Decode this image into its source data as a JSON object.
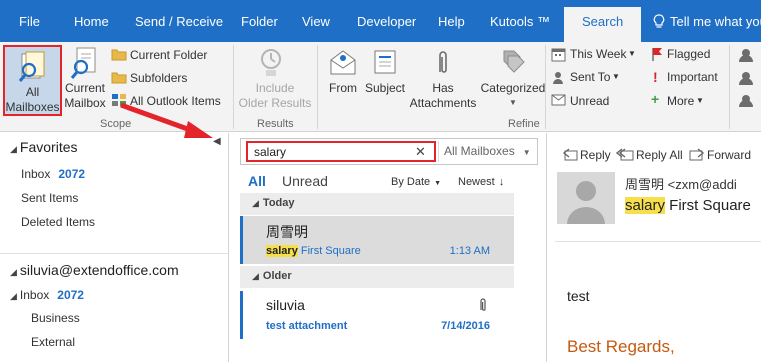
{
  "tabs": [
    "File",
    "Home",
    "Send / Receive",
    "Folder",
    "View",
    "Developer",
    "Help",
    "Kutools ™"
  ],
  "active_tab": "Search",
  "tell_me": "Tell me what you",
  "ribbon": {
    "scope": {
      "all_mailboxes_1": "All",
      "all_mailboxes_2": "Mailboxes",
      "current_mailbox_1": "Current",
      "current_mailbox_2": "Mailbox",
      "current_folder": "Current Folder",
      "subfolders": "Subfolders",
      "all_outlook_items": "All Outlook Items",
      "group_label": "Scope"
    },
    "results": {
      "include_1": "Include",
      "include_2": "Older Results",
      "group_label": "Results"
    },
    "refine": {
      "from": "From",
      "subject": "Subject",
      "has_1": "Has",
      "has_2": "Attachments",
      "categorized": "Categorized",
      "this_week": "This Week",
      "sent_to": "Sent To",
      "unread": "Unread",
      "flagged": "Flagged",
      "important": "Important",
      "more": "More",
      "group_label": "Refine"
    }
  },
  "nav": {
    "favorites": "Favorites",
    "inbox": "Inbox",
    "inbox_count": "2072",
    "sent_items": "Sent Items",
    "deleted_items": "Deleted Items",
    "account": "siluvia@extendoffice.com",
    "account_inbox": "Inbox",
    "account_inbox_count": "2072",
    "business": "Business",
    "external": "External"
  },
  "search": {
    "query": "salary",
    "clear": "✕",
    "scope": "All Mailboxes"
  },
  "list": {
    "filter_all": "All",
    "filter_unread": "Unread",
    "sort_by": "By Date",
    "sort_order": "Newest",
    "groups": [
      {
        "label": "Today",
        "sender": "周雪明",
        "subject_hl": "salary",
        "subject_rest": " First Square",
        "time": "1:13 AM"
      },
      {
        "label": "Older",
        "sender": "siluvia",
        "subject_hl": "",
        "subject_rest": "test attachment",
        "time": "7/14/2016"
      }
    ]
  },
  "reading": {
    "reply": "Reply",
    "reply_all": "Reply All",
    "forward": "Forward",
    "from": "周雪明 <zxm@addi",
    "subject_hl": "salary",
    "subject_rest": " First Square",
    "body": "test",
    "signature": "Best Regards,"
  },
  "colors": {
    "ribbon_blue": "#1e6fc5",
    "highlight": "#f7df4b",
    "annotation_red": "#e3242b"
  }
}
